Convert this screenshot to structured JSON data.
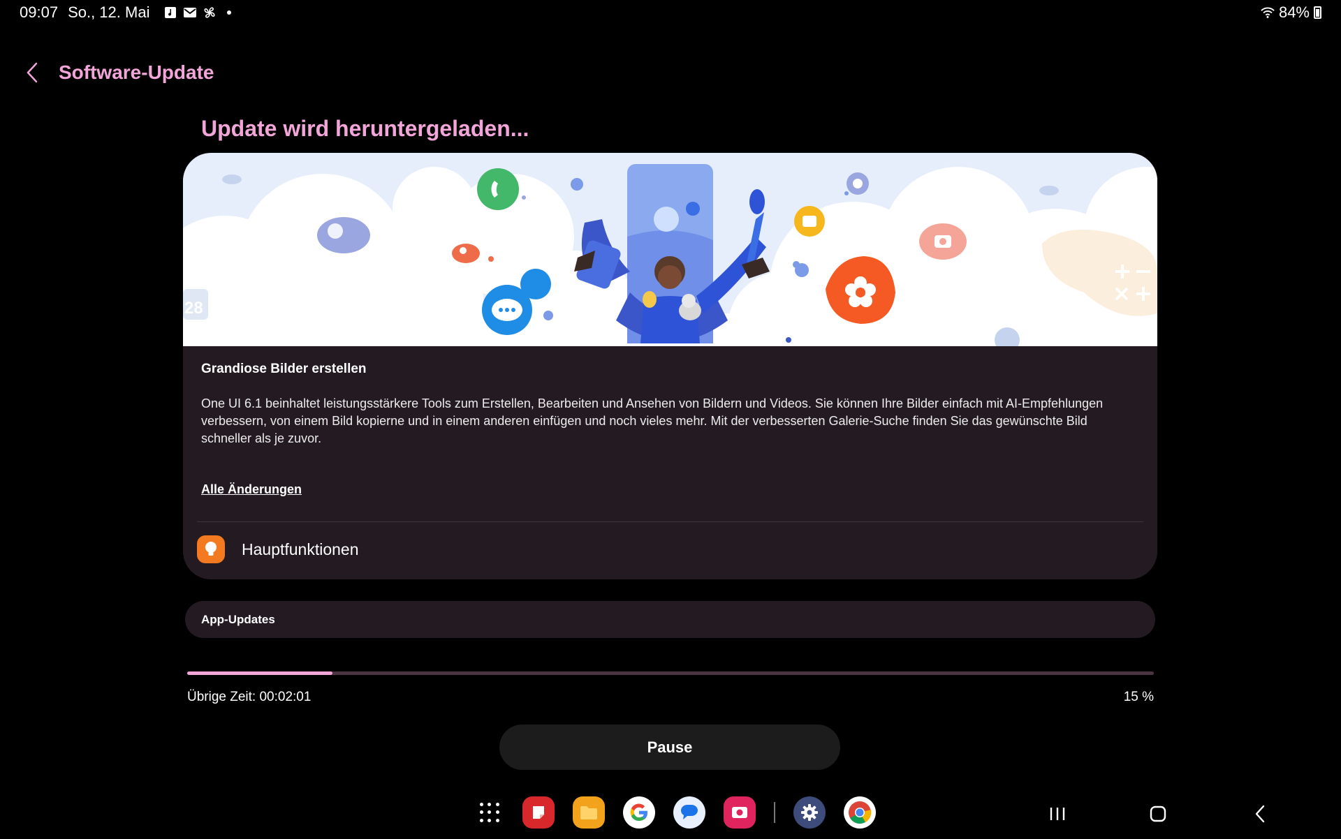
{
  "status_bar": {
    "time": "09:07",
    "date": "So., 12. Mai",
    "battery": "84%"
  },
  "header": {
    "title": "Software-Update"
  },
  "download": {
    "title": "Update wird heruntergeladen..."
  },
  "banner_illustration": {
    "calendar_number": "28"
  },
  "feature": {
    "title": "Grandiose Bilder erstellen",
    "description": "One UI 6.1 beinhaltet leistungsstärkere Tools zum Erstellen, Bearbeiten und Ansehen von Bildern und Videos. Sie können Ihre Bilder einfach mit AI-Empfehlungen verbessern, von einem Bild kopierne und in einem anderen einfügen und noch vieles mehr. Mit der verbesserten Galerie-Suche finden Sie das gewünschte Bild schneller als je zuvor.",
    "all_changes_label": "Alle Änderungen",
    "key_features_label": "Hauptfunktionen"
  },
  "app_updates": {
    "label": "App-Updates"
  },
  "progress": {
    "remaining_label": "Übrige Zeit: 00:02:01",
    "percent_label": "15 %",
    "fraction": 0.15
  },
  "pause_button": {
    "label": "Pause"
  },
  "dock": {
    "apps": [
      "samsung-notes-icon",
      "my-files-icon",
      "google-icon",
      "messages-icon",
      "screen-recorder-icon",
      "settings-icon",
      "chrome-icon"
    ]
  },
  "colors": {
    "accent": "#f2a5d8",
    "card_background": "#241b22",
    "progress_track": "#4a3442",
    "key_feature_icon": "#f37a21"
  }
}
